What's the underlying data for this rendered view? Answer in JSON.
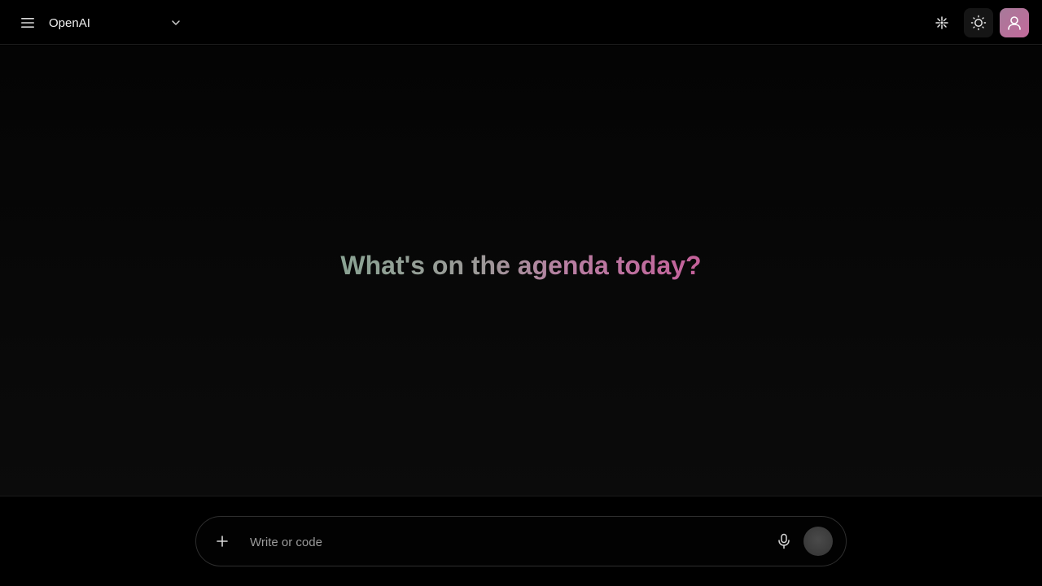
{
  "header": {
    "model_label": "OpenAI",
    "menu_icon": "hamburger-menu-icon",
    "chevron_icon": "chevron-down-icon",
    "sparkle_icon": "sparkle-icon",
    "theme_icon": "sun-icon",
    "avatar_icon": "user-icon"
  },
  "main": {
    "greeting": "What's on the agenda today?"
  },
  "composer": {
    "placeholder": "Write or code",
    "plus_icon": "plus-icon",
    "mic_icon": "microphone-icon"
  },
  "colors": {
    "background": "#000000",
    "greeting_gradient_start": "#8aa393",
    "greeting_gradient_end": "#c4609a",
    "avatar_gradient_start": "#a77a9a",
    "avatar_gradient_end": "#c26a9b"
  }
}
